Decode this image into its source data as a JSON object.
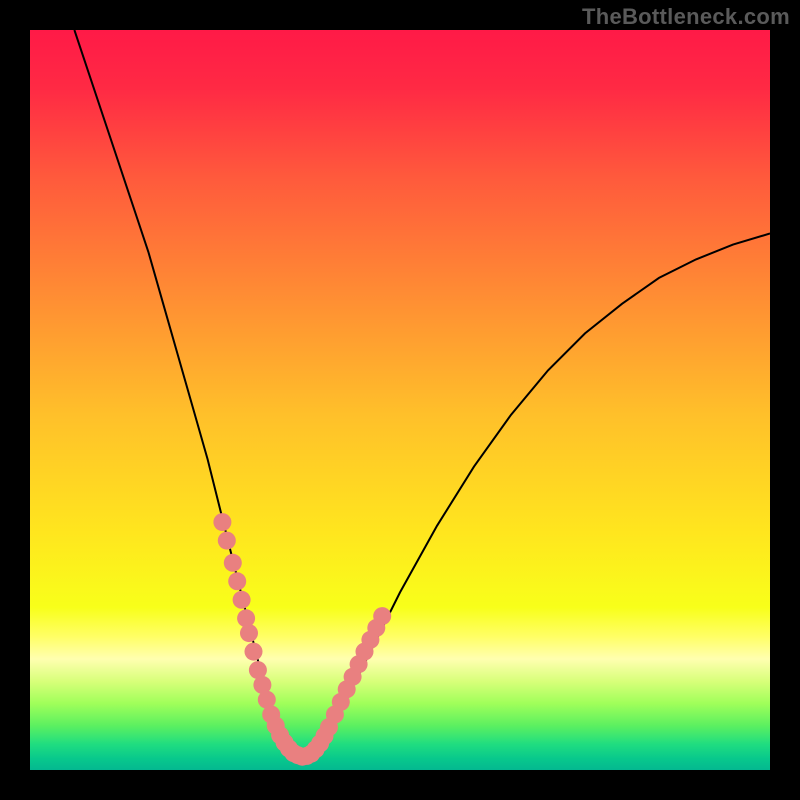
{
  "watermark": "TheBottleneck.com",
  "chart_data": {
    "type": "line",
    "title": "",
    "xlabel": "",
    "ylabel": "",
    "xlim": [
      0,
      100
    ],
    "ylim": [
      0,
      100
    ],
    "grid": false,
    "series": [
      {
        "name": "curve",
        "style": "black-thin-line",
        "x": [
          6,
          8,
          10,
          12,
          14,
          16,
          18,
          20,
          22,
          24,
          26,
          28,
          30,
          31,
          32,
          33,
          34,
          35,
          36,
          37,
          38,
          39,
          40,
          42,
          44,
          46,
          48,
          50,
          55,
          60,
          65,
          70,
          75,
          80,
          85,
          90,
          95,
          100
        ],
        "y": [
          100,
          94,
          88,
          82,
          76,
          70,
          63,
          56,
          49,
          42,
          34,
          26,
          18,
          14,
          10,
          7,
          4.5,
          2.9,
          2,
          1.7,
          2,
          2.9,
          4.2,
          8,
          12,
          16,
          20,
          24,
          33,
          41,
          48,
          54,
          59,
          63,
          66.5,
          69,
          71,
          72.5
        ]
      },
      {
        "name": "highlight-dots",
        "style": "salmon-dots",
        "x": [
          26.0,
          26.6,
          27.4,
          28.0,
          28.6,
          29.2,
          29.6,
          30.2,
          30.8,
          31.4,
          32.0,
          32.6,
          33.2,
          33.8,
          34.4,
          35.0,
          35.6,
          36.2,
          36.8,
          37.4,
          38.0,
          38.6,
          39.2,
          39.8,
          40.4,
          41.2,
          42.0,
          42.8,
          43.6,
          44.4,
          45.2,
          46.0,
          46.8,
          47.6
        ],
        "y": [
          33.5,
          31.0,
          28.0,
          25.5,
          23.0,
          20.5,
          18.5,
          16.0,
          13.5,
          11.5,
          9.5,
          7.5,
          6.0,
          4.7,
          3.7,
          2.9,
          2.3,
          2.0,
          1.8,
          1.9,
          2.2,
          2.8,
          3.6,
          4.6,
          5.8,
          7.5,
          9.2,
          10.9,
          12.6,
          14.3,
          16.0,
          17.6,
          19.2,
          20.8
        ]
      }
    ],
    "background_gradient": {
      "stops": [
        {
          "pos": 0.0,
          "color": "#ff1a47"
        },
        {
          "pos": 0.08,
          "color": "#ff2a44"
        },
        {
          "pos": 0.2,
          "color": "#ff5a3c"
        },
        {
          "pos": 0.35,
          "color": "#ff8a34"
        },
        {
          "pos": 0.52,
          "color": "#ffc02a"
        },
        {
          "pos": 0.68,
          "color": "#ffe61e"
        },
        {
          "pos": 0.78,
          "color": "#f8ff1a"
        },
        {
          "pos": 0.82,
          "color": "#ffff66"
        },
        {
          "pos": 0.85,
          "color": "#ffffb0"
        },
        {
          "pos": 0.88,
          "color": "#d8ff7a"
        },
        {
          "pos": 0.91,
          "color": "#a0ff5a"
        },
        {
          "pos": 0.94,
          "color": "#5cf060"
        },
        {
          "pos": 0.965,
          "color": "#20dd80"
        },
        {
          "pos": 0.985,
          "color": "#08c88c"
        },
        {
          "pos": 1.0,
          "color": "#04b890"
        }
      ]
    }
  }
}
